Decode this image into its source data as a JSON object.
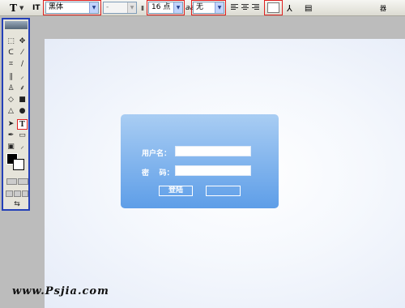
{
  "options_bar": {
    "type_tool_label": "T",
    "orientation_label": "IT",
    "font_family": "黑体",
    "font_style": "-",
    "font_size_label": "16 点",
    "antialias_prefix": "aa",
    "antialias": "无",
    "right_label": "器"
  },
  "form": {
    "username_label": "用户名：",
    "password_label": "密    码：",
    "login_button": "登陆",
    "second_button": ""
  },
  "watermark": "www.Psjia.com",
  "colors": {
    "panel_top": "#a9cdf3",
    "panel_bottom": "#5e9ee8",
    "highlight_red": "#e02020",
    "toolbox_border": "#2440b8",
    "foreground": "#000000",
    "background": "#ffffff"
  }
}
